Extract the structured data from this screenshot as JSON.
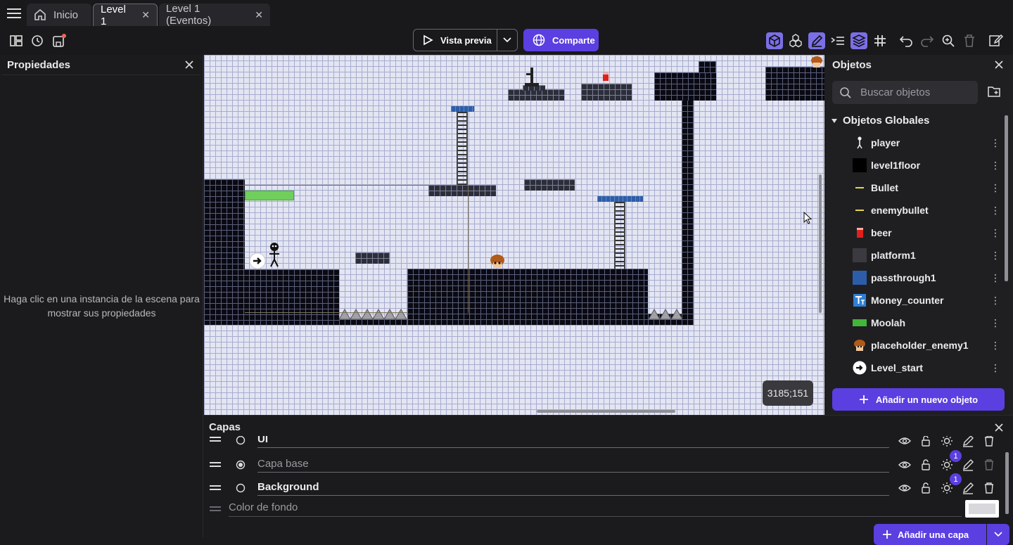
{
  "tabs": [
    {
      "label": "Inicio"
    },
    {
      "label": "Level 1"
    },
    {
      "label": "Level 1 (Eventos)"
    }
  ],
  "toolbar": {
    "preview_label": "Vista previa",
    "share_label": "Comparte"
  },
  "properties": {
    "title": "Propiedades",
    "hint": "Haga clic en una instancia de la escena para mostrar sus propiedades"
  },
  "scene": {
    "coordinates": "3185;151"
  },
  "objects": {
    "title": "Objetos",
    "search_placeholder": "Buscar objetos",
    "group_label": "Objetos Globales",
    "items": [
      {
        "label": "player",
        "icon": "stick-figure-icon"
      },
      {
        "label": "level1floor",
        "icon": "black-square-icon"
      },
      {
        "label": "Bullet",
        "icon": "yellow-line-icon"
      },
      {
        "label": "enemybullet",
        "icon": "yellow-line-icon"
      },
      {
        "label": "beer",
        "icon": "red-can-icon"
      },
      {
        "label": "platform1",
        "icon": "dark-square-icon"
      },
      {
        "label": "passthrough1",
        "icon": "blue-square-icon"
      },
      {
        "label": "Money_counter",
        "icon": "text-object-icon"
      },
      {
        "label": "Moolah",
        "icon": "green-bar-icon"
      },
      {
        "label": "placeholder_enemy1",
        "icon": "mushroom-enemy-icon"
      },
      {
        "label": "Level_start",
        "icon": "arrow-circle-icon"
      }
    ],
    "add_label": "Añadir un nuevo objeto"
  },
  "layers": {
    "title": "Capas",
    "items": [
      {
        "name": "UI",
        "badge": ""
      },
      {
        "name": "Capa base",
        "badge": "1"
      },
      {
        "name": "Background",
        "badge": "1"
      }
    ],
    "background_color_label": "Color de fondo",
    "add_label": "Añadir una capa"
  },
  "colors": {
    "accent": "#5b3fe0",
    "scene_bg": "#e3e6f2"
  }
}
